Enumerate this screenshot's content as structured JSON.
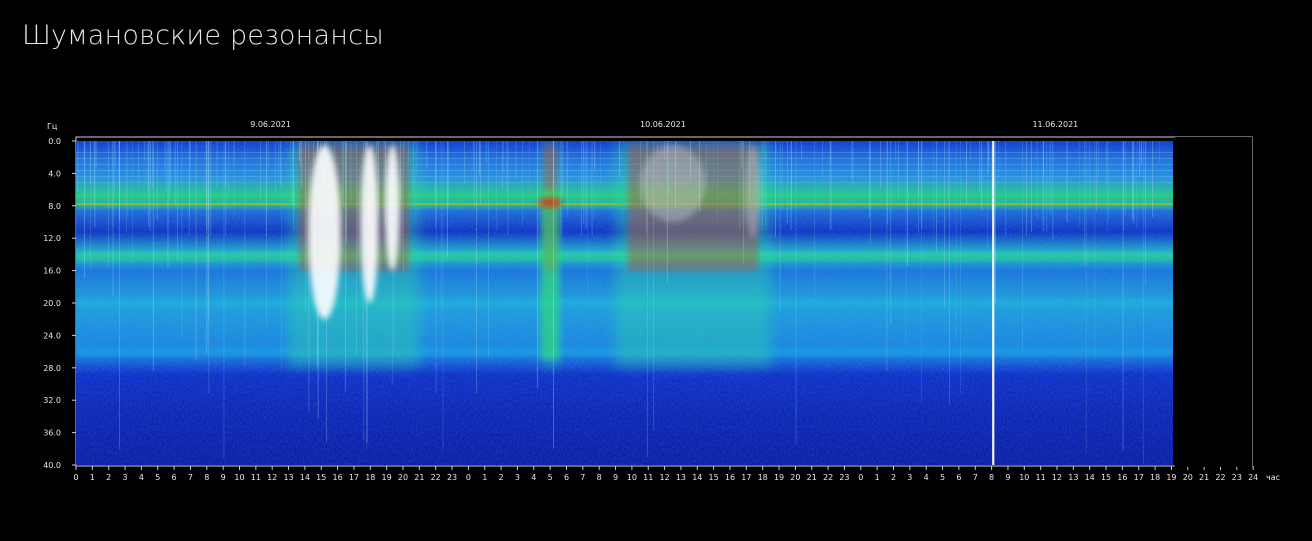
{
  "page": {
    "title": "Шумановские резонансы"
  },
  "chart_data": {
    "type": "heatmap",
    "title": "",
    "ylabel": "Гц",
    "xlabel": "час",
    "ylim": [
      0,
      40
    ],
    "yticks": [
      "0.0",
      "4.0",
      "8.0",
      "12.0",
      "16.0",
      "20.0",
      "24.0",
      "28.0",
      "32.0",
      "36.0",
      "40.0"
    ],
    "y_inverted": true,
    "days": [
      {
        "date": "9.06.2021",
        "hours": [
          "0",
          "1",
          "2",
          "3",
          "4",
          "5",
          "6",
          "7",
          "8",
          "9",
          "10",
          "11",
          "12",
          "13",
          "14",
          "15",
          "16",
          "17",
          "18",
          "19",
          "20",
          "21",
          "22",
          "23"
        ]
      },
      {
        "date": "10.06.2021",
        "hours": [
          "0",
          "1",
          "2",
          "3",
          "4",
          "5",
          "6",
          "7",
          "8",
          "9",
          "10",
          "11",
          "12",
          "13",
          "14",
          "15",
          "16",
          "17",
          "18",
          "19",
          "20",
          "21",
          "22",
          "23"
        ]
      },
      {
        "date": "11.06.2021",
        "hours": [
          "0",
          "1",
          "2",
          "3",
          "4",
          "5",
          "6",
          "7",
          "8",
          "9",
          "10",
          "11",
          "12",
          "13",
          "14",
          "15",
          "16",
          "17",
          "18",
          "19",
          "20",
          "21",
          "22",
          "23",
          "24"
        ]
      }
    ],
    "data_end": {
      "date": "11.06.2021",
      "hour": 19.2
    },
    "resonance_bands_hz": [
      7.8,
      14.3,
      20.0,
      26.0
    ],
    "intense_periods": [
      {
        "date": "9.06.2021",
        "from_hour": 13,
        "to_hour": 21
      },
      {
        "date": "10.06.2021",
        "from_hour": 4.5,
        "to_hour": 5.5
      },
      {
        "date": "10.06.2021",
        "from_hour": 9,
        "to_hour": 18.5
      }
    ],
    "spike": {
      "date": "11.06.2021",
      "hour": 8.1
    },
    "colors": {
      "background": "#000000",
      "low": "#0a1fb0",
      "mid": "#18c8e0",
      "band": "#20e070",
      "high": "#e03010",
      "saturated": "#ffffff"
    }
  }
}
